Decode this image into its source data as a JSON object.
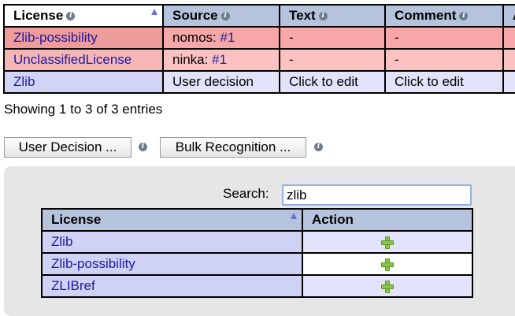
{
  "top_table": {
    "columns": [
      {
        "label": "License",
        "info": "i"
      },
      {
        "label": "Source",
        "info": "i"
      },
      {
        "label": "Text",
        "info": "i"
      },
      {
        "label": "Comment",
        "info": "i"
      },
      {
        "label": "A"
      }
    ],
    "rows": [
      {
        "license": "Zlib-possibility",
        "source_prefix": "nomos:",
        "source_link": "#1",
        "text": "-",
        "comment": "-"
      },
      {
        "license": "UnclassifiedLicense",
        "source_prefix": "ninka:",
        "source_link": "#1",
        "text": "-",
        "comment": "-"
      },
      {
        "license": "Zlib",
        "source_prefix": "User decision",
        "source_link": "",
        "text": "Click to edit",
        "comment": "Click to edit"
      }
    ],
    "info_text": "Showing 1 to 3 of 3 entries"
  },
  "buttons": {
    "user_decision": "User Decision ...",
    "bulk_recognition": "Bulk Recognition ...",
    "info": "i"
  },
  "search": {
    "label": "Search:",
    "value": "zlib"
  },
  "license_table": {
    "columns": [
      "License",
      "Action"
    ],
    "rows": [
      {
        "license": "Zlib"
      },
      {
        "license": "Zlib-possibility"
      },
      {
        "license": "ZLIBref"
      }
    ]
  },
  "colors": {
    "header_bg": "#b5c4dc",
    "row_red": "#f7a7a7",
    "row_pink": "#fcc2c2",
    "row_blue": "#e2e3fb",
    "link": "#1a1aa8",
    "add_icon": "#8cc24a"
  }
}
